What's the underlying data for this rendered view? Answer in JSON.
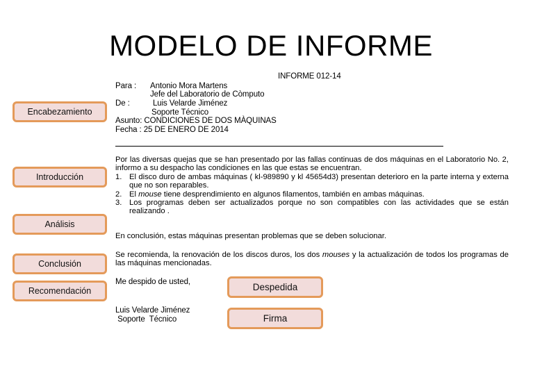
{
  "title": "MODELO DE INFORME",
  "header": {
    "report_number": "INFORME 012-14",
    "para_label": "Para   :",
    "para_name": "Antonio Mora Martens",
    "para_role": "Jefe del Laboratorio de Còmputo",
    "de_label": "De        :",
    "de_name": "Luis Velarde Jiménez",
    "de_role": "Soporte  Técnico",
    "asunto": "Asunto: CONDICIONES DE DOS MÀQUINAS",
    "fecha": "Fecha   :  25 DE ENERO DE 2014"
  },
  "sections": {
    "encabezamiento": "Encabezamiento",
    "introduccion": "Introducción",
    "analisis": "Análisis",
    "conclusion": "Conclusión",
    "recomendacion": "Recomendación",
    "despedida": "Despedida",
    "firma": "Firma"
  },
  "body": {
    "intro": "Por las diversas quejas que se han presentado por las fallas continuas de dos máquinas en el Laboratorio No. 2, informo a su despacho las condiciones en las que estas se encuentran.",
    "items": [
      {
        "n": "1.",
        "pre": "El disco duro de ambas máquinas ( kl-989890  y kl 45654d3)  presentan deterioro en la parte interna y externa que no son reparables.",
        "em": "",
        "post": ""
      },
      {
        "n": "2.",
        "pre": "El ",
        "em": "mouse",
        "post": " tiene desprendimiento en algunos filamentos, también en ambas máquinas."
      },
      {
        "n": "3.",
        "pre": "Los programas deben ser actualizados  porque no son compatibles con las actividades que se están realizando .",
        "em": "",
        "post": ""
      }
    ],
    "conclusion": "En conclusión, estas máquinas presentan problemas que se deben solucionar.",
    "recommendation_pre": "Se recomienda,  la renovación de los discos duros, los dos ",
    "recommendation_em": "mouses",
    "recommendation_post": "  y  la actualización de todos  los programas de las máquinas mencionadas.",
    "closing": "Me despido de usted,",
    "signature_name": "Luis Velarde Jiménez",
    "signature_role": " Soporte  Técnico"
  }
}
